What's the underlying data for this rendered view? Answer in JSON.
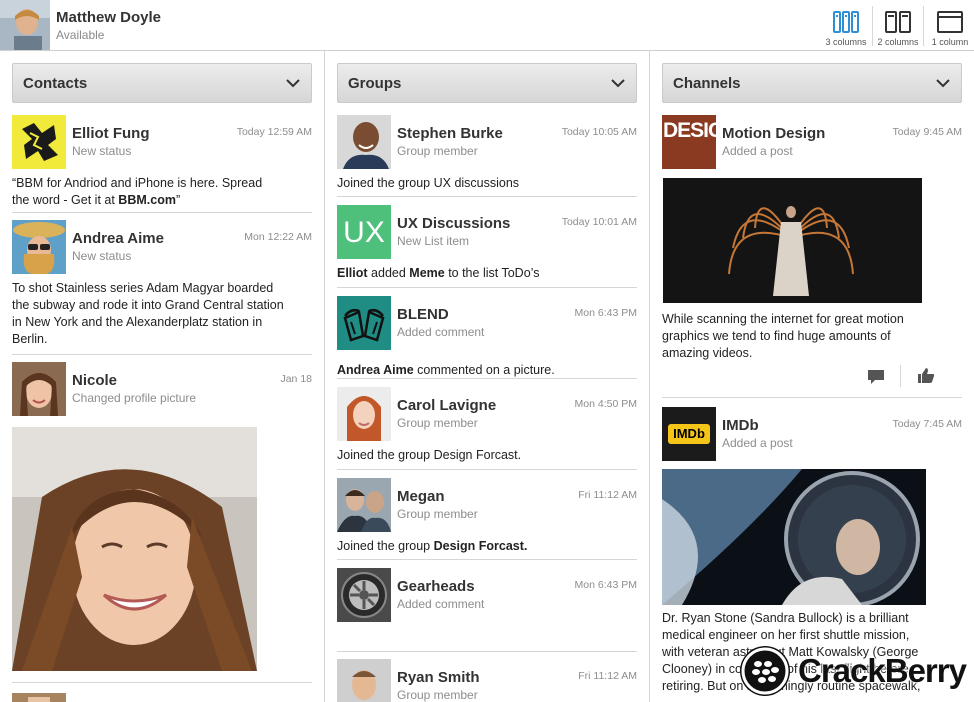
{
  "profile": {
    "name": "Matthew Doyle",
    "status": "Available"
  },
  "view_modes": [
    {
      "label": "3 columns",
      "icon": "three-columns-icon",
      "active": true
    },
    {
      "label": "2 columns",
      "icon": "two-columns-icon",
      "active": false
    },
    {
      "label": "1 column",
      "icon": "one-column-icon",
      "active": false
    }
  ],
  "colors": {
    "accent": "#2f8fd6",
    "header_gradient_top": "#ececec",
    "header_gradient_bottom": "#d6d6d6",
    "divider": "#d6d6d6"
  },
  "contacts": {
    "title": "Contacts",
    "items": [
      {
        "name": "Elliot Fung",
        "sub": "New status",
        "time": "Today 12:59 AM",
        "text_pre": "“BBM for Andriod and iPhone is here. Spread the word - Get it at ",
        "text_bold": "BBM.com",
        "text_post": "”"
      },
      {
        "name": "Andrea Aime",
        "sub": "New status",
        "time": "Mon 12:22 AM",
        "text": "To shot Stainless series Adam Magyar boarded the subway and rode it into Grand Central station in New York and the Alexanderplatz station in Berlin."
      },
      {
        "name": "Nicole",
        "sub": "Changed profile picture",
        "time": "Jan 18"
      }
    ]
  },
  "groups": {
    "title": "Groups",
    "items": [
      {
        "name": "Stephen Burke",
        "sub": "Group member",
        "time": "Today 10:05 AM",
        "text": "Joined the group UX discussions"
      },
      {
        "name": "UX Discussions",
        "sub": "New List item",
        "time": "Today 10:01 AM",
        "thumb_text": "UX",
        "actor": "Elliot",
        "mid1": " added ",
        "obj": "Meme",
        "mid2": " to the list ToDo’s"
      },
      {
        "name": "BLEND",
        "sub": "Added comment",
        "time": "Mon 6:43 PM",
        "actor": "Andrea Aime",
        "rest": " commented on a picture."
      },
      {
        "name": "Carol Lavigne",
        "sub": "Group member",
        "time": "Mon 4:50 PM",
        "text": "Joined the group Design Forcast."
      },
      {
        "name": "Megan",
        "sub": "Group member",
        "time": "Fri 11:12 AM",
        "pre": "Joined the group ",
        "bold": "Design Forcast."
      },
      {
        "name": "Gearheads",
        "sub": "Added comment",
        "time": "Mon 6:43 PM"
      },
      {
        "name": "Ryan Smith",
        "sub": "Group member",
        "time": "Fri 11:12 AM"
      }
    ]
  },
  "channels": {
    "title": "Channels",
    "items": [
      {
        "name": "Motion Design",
        "sub": "Added a post",
        "time": "Today 9:45 AM",
        "thumb_text": "DESIG",
        "text": "While scanning the internet for great motion graphics we tend to find huge amounts of amazing videos."
      },
      {
        "name": "IMDb",
        "sub": "Added a post",
        "time": "Today 7:45 AM",
        "thumb_text": "IMDb",
        "text": "Dr. Ryan Stone (Sandra Bullock) is a brilliant medical engineer on her first shuttle mission, with veteran astronaut Matt Kowalsky (George Clooney) in command of his last flight before retiring. But on a seemingly routine spacewalk,"
      }
    ]
  },
  "watermark": {
    "text": "CrackBerry"
  }
}
